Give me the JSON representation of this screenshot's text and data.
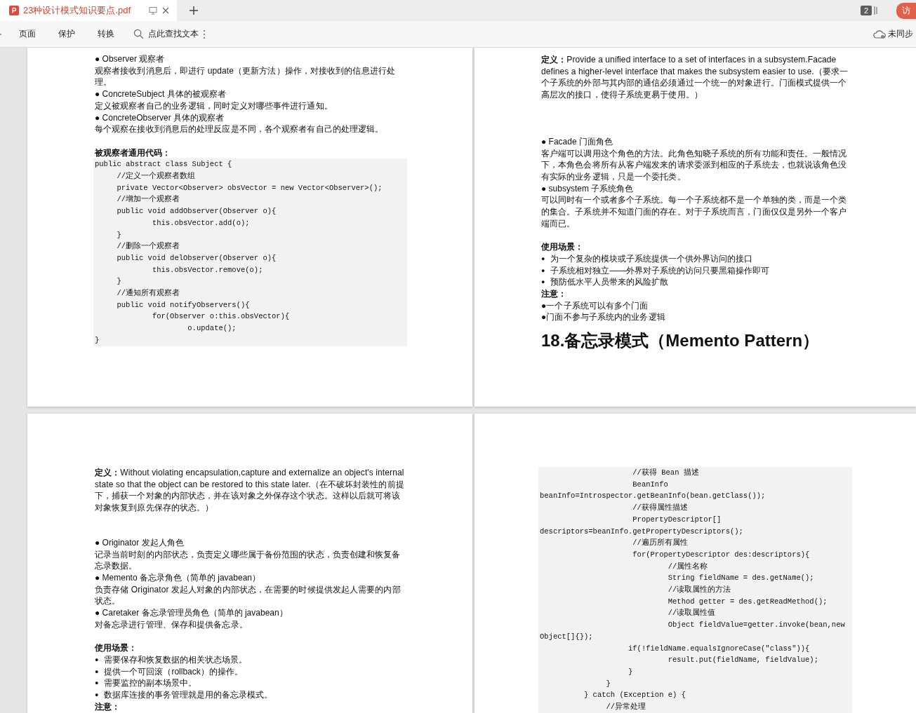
{
  "tab": {
    "title": "23种设计模式知识要点.pdf",
    "selected": true
  },
  "tab_count": "2",
  "visitor_button": "访",
  "toolbar": {
    "items": [
      {
        "label": "页面"
      },
      {
        "label": "保护"
      },
      {
        "label": "转换"
      }
    ],
    "search_label": "点此查找文本",
    "sync_status": "未同步"
  },
  "pages": [
    {
      "blocks": [
        {
          "kind": "role",
          "text": "● Observer 观察者"
        },
        {
          "kind": "para",
          "text": "观察者接收到消息后，即进行 update（更新方法）操作，对接收到的信息进行处理。"
        },
        {
          "kind": "role",
          "text": "● ConcreteSubject 具体的被观察者"
        },
        {
          "kind": "para",
          "text": "定义被观察者自己的业务逻辑，同时定义对哪些事件进行通知。"
        },
        {
          "kind": "role",
          "text": "● ConcreteObserver 具体的观察者"
        },
        {
          "kind": "para",
          "text": "每个观察在接收到消息后的处理反应是不同，各个观察者有自己的处理逻辑。"
        },
        {
          "kind": "label",
          "text": "被观察者通用代码："
        },
        {
          "kind": "code",
          "lines": [
            "public abstract class Subject {",
            "     //定义一个观察者数组",
            "     private Vector<Observer> obsVector = new Vector<Observer>();",
            "     //增加一个观察者",
            "     public void addObserver(Observer o){",
            "             this.obsVector.add(o);",
            "     }",
            "     //删除一个观察者",
            "     public void delObserver(Observer o){",
            "             this.obsVector.remove(o);",
            "     }",
            "     //通知所有观察者",
            "     public void notifyObservers(){",
            "             for(Observer o:this.obsVector){",
            "                     o.update();",
            "}"
          ]
        }
      ]
    },
    {
      "blocks": [
        {
          "kind": "definition",
          "text": "**定义：**Provide a unified interface to a set of interfaces in a subsystem.Facade defines a higher-level interface that makes the subsystem easier to use.（要求一个子系统的外部与其内部的通信必须通过一个统一的对象进行。门面模式提供一个高层次的接口，使得子系统更易于使用。）"
        },
        {
          "kind": "role",
          "text": "● Facade 门面角色"
        },
        {
          "kind": "para",
          "text": "客户端可以调用这个角色的方法。此角色知晓子系统的所有功能和责任。一般情况下，本角色会将所有从客户端发来的请求委派到相应的子系统去，也就说该角色没有实际的业务逻辑，只是一个委托类。"
        },
        {
          "kind": "role",
          "text": "● subsystem 子系统角色"
        },
        {
          "kind": "para",
          "text": "可以同时有一个或者多个子系统。每一个子系统都不是一个单独的类，而是一个类的集合。子系统并不知道门面的存在。对于子系统而言，门面仅仅是另外一个客户端而已。"
        },
        {
          "kind": "label",
          "text": "使用场景："
        },
        {
          "kind": "list-item",
          "bullet": "●",
          "text": "为一个复杂的模块或子系统提供一个供外界访问的接口"
        },
        {
          "kind": "list-item",
          "bullet": "●",
          "text": "子系统相对独立——外界对子系统的访问只要黑箱操作即可"
        },
        {
          "kind": "list-item",
          "bullet": "●",
          "text": "预防低水平人员带来的风险扩散"
        },
        {
          "kind": "label",
          "text": "注意："
        },
        {
          "kind": "para",
          "text": "●一个子系统可以有多个门面"
        },
        {
          "kind": "para",
          "text": "●门面不参与子系统内的业务逻辑"
        },
        {
          "kind": "title",
          "text": "18.备忘录模式（Memento Pattern）"
        }
      ]
    },
    {
      "blocks": [
        {
          "kind": "definition",
          "text": "**定义：**Without violating encapsulation,capture and externalize an object's internal state so that the object can be restored to this state later.（在不破坏封装性的前提下，捕获一个对象的内部状态，并在该对象之外保存这个状态。这样以后就可将该对象恢复到原先保存的状态。）"
        },
        {
          "kind": "role",
          "text": "● Originator 发起人角色"
        },
        {
          "kind": "para",
          "text": "记录当前时刻的内部状态，负责定义哪些属于备份范围的状态，负责创建和恢复备忘录数据。"
        },
        {
          "kind": "role",
          "text": "● Memento 备忘录角色（简单的 javabean）"
        },
        {
          "kind": "para",
          "text": "负责存储 Originator 发起人对象的内部状态，在需要的时候提供发起人需要的内部状态。"
        },
        {
          "kind": "role",
          "text": "● Caretaker 备忘录管理员角色（简单的 javabean）"
        },
        {
          "kind": "para",
          "text": "对备忘录进行管理、保存和提供备忘录。"
        },
        {
          "kind": "label",
          "text": "使用场景："
        },
        {
          "kind": "list-item",
          "bullet": "●",
          "text": "需要保存和恢复数据的相关状态场景。"
        },
        {
          "kind": "list-item",
          "bullet": "●",
          "text": "提供一个可回滚（rollback）的操作。"
        },
        {
          "kind": "list-item",
          "bullet": "●",
          "text": "需要监控的副本场景中。"
        },
        {
          "kind": "list-item",
          "bullet": "●",
          "text": "数据库连接的事务管理就是用的备忘录模式。"
        },
        {
          "kind": "label",
          "text": "注意："
        }
      ]
    },
    {
      "blocks": [
        {
          "kind": "code",
          "lines": [
            "                     //获得 Bean 描述",
            "                     BeanInfo",
            "beanInfo=Introspector.getBeanInfo(bean.getClass());",
            "                     //获得属性描述",
            "                     PropertyDescriptor[]",
            "descriptors=beanInfo.getPropertyDescriptors();",
            "                     //遍历所有属性",
            "                     for(PropertyDescriptor des:descriptors){",
            "                             //属性名称",
            "                             String fieldName = des.getName();",
            "                             //读取属性的方法",
            "                             Method getter = des.getReadMethod();",
            "                             //读取属性值",
            "                             Object fieldValue=getter.invoke(bean,new",
            "Object[]{});",
            "                    if(!fieldName.equalsIgnoreCase(\"class\")){",
            "                             result.put(fieldName, fieldValue);",
            "                    }",
            "               }",
            "          } catch (Exception e) {",
            "               //异常处理"
          ]
        }
      ]
    }
  ]
}
